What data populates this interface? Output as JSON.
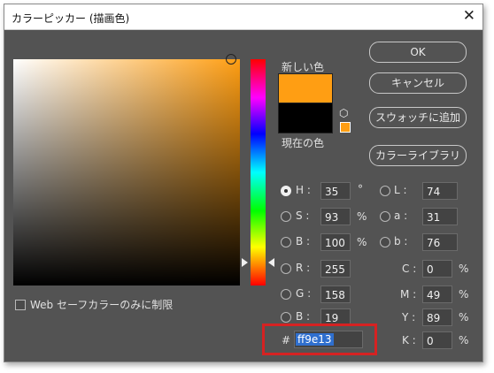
{
  "window": {
    "title": "カラーピッカー (描画色)",
    "close_glyph": "✕"
  },
  "colors": {
    "current_color": "#ff9e13",
    "previous_color": "#000000",
    "highlight": "#d62222"
  },
  "labels": {
    "new": "新しい色",
    "current": "現在の色"
  },
  "buttons": {
    "ok": "OK",
    "cancel": "キャンセル",
    "add_swatch": "スウォッチに追加",
    "libraries": "カラーライブラリ"
  },
  "hsb": [
    {
      "key": "H :",
      "value": "35",
      "unit": "°",
      "selected": true
    },
    {
      "key": "S :",
      "value": "93",
      "unit": "%",
      "selected": false
    },
    {
      "key": "B :",
      "value": "100",
      "unit": "%",
      "selected": false
    }
  ],
  "lab": [
    {
      "key": "L :",
      "value": "74"
    },
    {
      "key": "a :",
      "value": "31"
    },
    {
      "key": "b :",
      "value": "76"
    }
  ],
  "rgb": [
    {
      "key": "R :",
      "value": "255"
    },
    {
      "key": "G :",
      "value": "158"
    },
    {
      "key": "B :",
      "value": "19"
    }
  ],
  "cmyk": [
    {
      "key": "C :",
      "value": "0",
      "unit": "%"
    },
    {
      "key": "M :",
      "value": "49",
      "unit": "%"
    },
    {
      "key": "Y :",
      "value": "89",
      "unit": "%"
    },
    {
      "key": "K :",
      "value": "0",
      "unit": "%"
    }
  ],
  "hex": {
    "prefix": "#",
    "value": "ff9e13"
  },
  "web_safe": {
    "label": "Web セーフカラーのみに制限",
    "checked": false
  },
  "icons": {
    "gamut_cube": "cube-icon"
  }
}
